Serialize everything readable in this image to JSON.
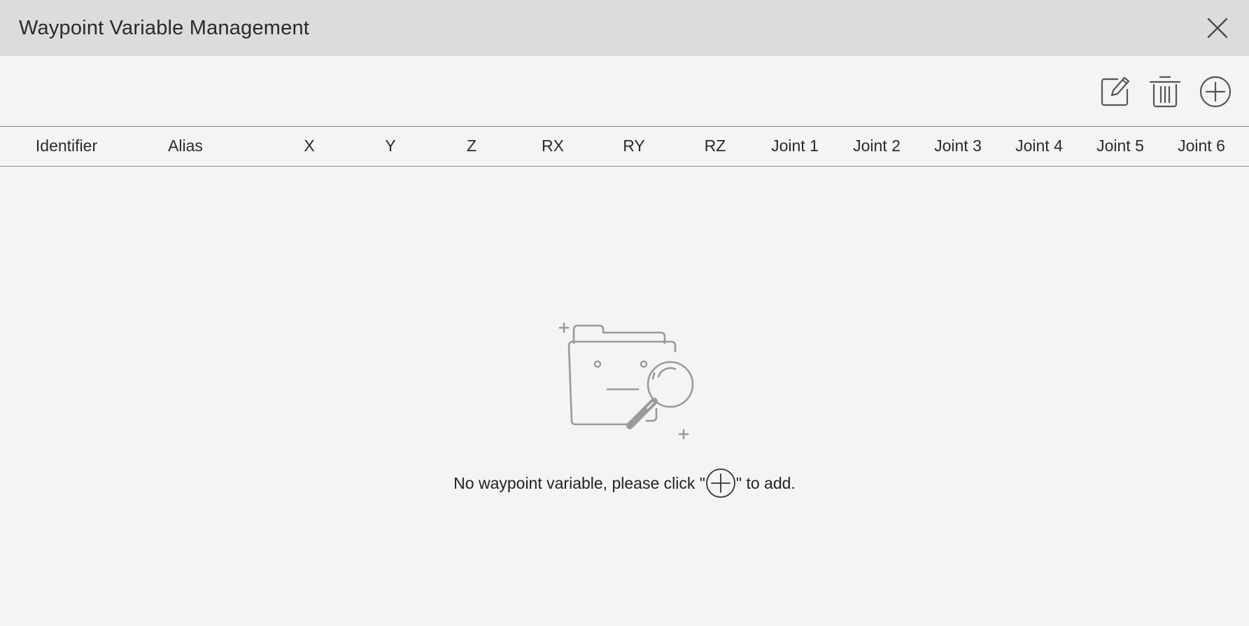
{
  "window": {
    "title": "Waypoint Variable Management",
    "close_icon": "close-icon"
  },
  "toolbar": {
    "edit_icon": "edit-icon",
    "delete_icon": "trash-icon",
    "add_icon": "plus-circle-icon"
  },
  "table": {
    "columns": [
      "Identifier",
      "Alias",
      "X",
      "Y",
      "Z",
      "RX",
      "RY",
      "RZ",
      "Joint 1",
      "Joint 2",
      "Joint 3",
      "Joint 4",
      "Joint 5",
      "Joint 6"
    ],
    "rows": []
  },
  "empty_state": {
    "illustration_icon": "empty-folder-search-icon",
    "message_before": "No waypoint variable, please click \"",
    "message_icon": "plus-circle-icon",
    "message_after": "\" to add."
  },
  "colors": {
    "title_bar": "#dcdcdc",
    "background": "#f4f4f4",
    "icon_gray": "#9a9a9a",
    "text": "#222222"
  }
}
